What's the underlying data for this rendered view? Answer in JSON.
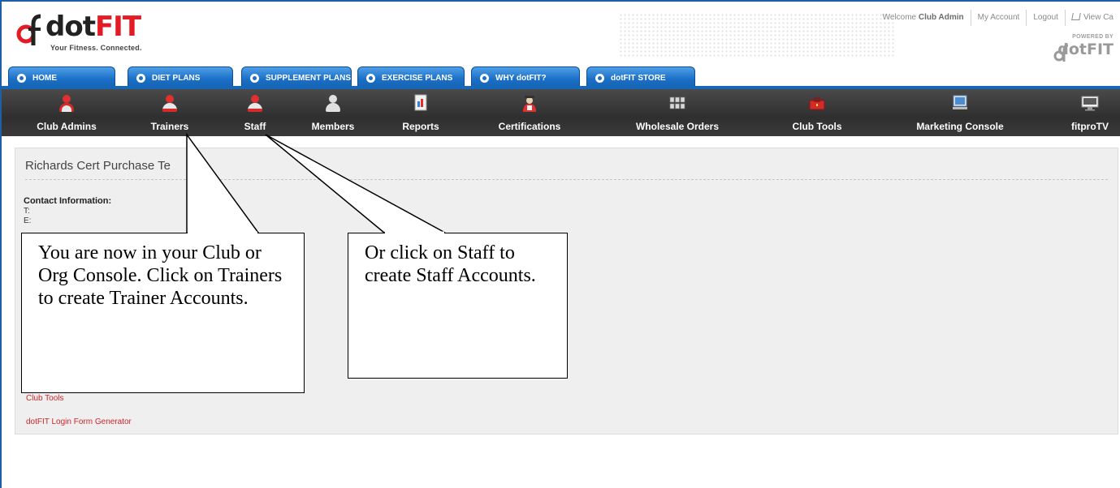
{
  "header": {
    "logo_dot": "dot",
    "logo_fit": "FIT",
    "logo_tagline": "Your Fitness. Connected.",
    "welcome_prefix": "Welcome",
    "welcome_user": "Club Admin",
    "my_account": "My Account",
    "logout": "Logout",
    "view_cart": "View Ca",
    "powered_by": "POWERED BY",
    "powered_logo": "dotFIT"
  },
  "tabs": [
    {
      "label": "HOME"
    },
    {
      "label": "DIET PLANS"
    },
    {
      "label": "SUPPLEMENT PLANS"
    },
    {
      "label": "EXERCISE PLANS"
    },
    {
      "label": "WHY dotFIT?"
    },
    {
      "label": "dotFIT STORE"
    }
  ],
  "console": [
    {
      "label": "Club Admins",
      "icon": "club-admin-icon"
    },
    {
      "label": "Trainers",
      "icon": "trainer-icon"
    },
    {
      "label": "Staff",
      "icon": "staff-icon"
    },
    {
      "label": "Members",
      "icon": "member-icon"
    },
    {
      "label": "Reports",
      "icon": "report-icon"
    },
    {
      "label": "Certifications",
      "icon": "certification-icon"
    },
    {
      "label": "Wholesale Orders",
      "icon": "wholesale-orders-icon"
    },
    {
      "label": "Club Tools",
      "icon": "toolbox-icon"
    },
    {
      "label": "Marketing Console",
      "icon": "marketing-console-icon"
    },
    {
      "label": "fitproTV",
      "icon": "fitprotv-icon"
    }
  ],
  "content": {
    "title": "Richards Cert Purchase Te",
    "contact_heading": "Contact Information:",
    "phone_label": "T:",
    "email_label": "E:",
    "links": [
      "Club Tools",
      "dotFIT Login Form Generator"
    ]
  },
  "callouts": {
    "trainers": "You are now in your Club or Org Console. Click on Trainers to create Trainer Accounts.",
    "staff": "Or click on Staff to create Staff Accounts."
  },
  "colors": {
    "brand_red": "#e21b24",
    "tab_blue": "#1a6fc6",
    "console_bg": "#3a3a3a",
    "link_red": "#d0262c"
  }
}
